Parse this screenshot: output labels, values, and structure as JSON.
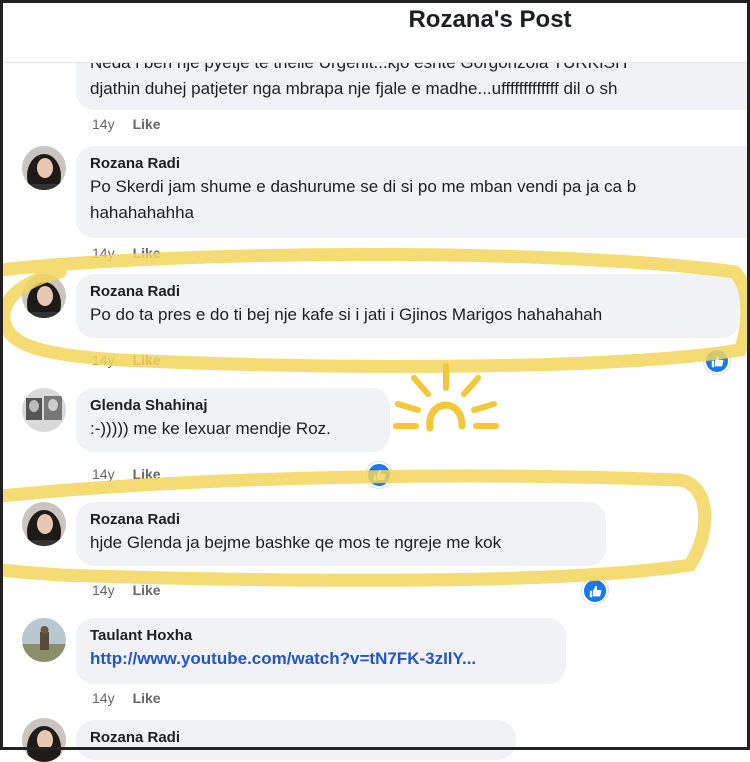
{
  "header": {
    "title": "Rozana's Post"
  },
  "comments": [
    {
      "author": "",
      "lines": [
        "Neda i beri nje pyetje te thelle Urgenit...kjo eshte Gorgonzola TURKISH",
        "djathin duhej patjeter nga mbrapa nje fjale e madhe...ufffffffffffff dil o sh"
      ],
      "time": "14y",
      "like": "Like"
    },
    {
      "author": "Rozana Radi",
      "lines": [
        "Po Skerdi jam shume e dashurume se di si po me mban vendi pa ja ca b",
        "hahahahahha"
      ],
      "time": "14y",
      "like": "Like"
    },
    {
      "author": "Rozana Radi",
      "lines": [
        "Po do ta pres e do ti bej nje kafe si i jati i Gjinos Marigos hahahahah"
      ],
      "time": "14y",
      "like": "Like"
    },
    {
      "author": "Glenda Shahinaj",
      "lines": [
        ":-))))) me ke lexuar mendje Roz."
      ],
      "time": "14y",
      "like": "Like"
    },
    {
      "author": "Rozana Radi",
      "lines": [
        "hjde Glenda ja bejme bashke qe mos te ngreje me kok"
      ],
      "time": "14y",
      "like": "Like"
    },
    {
      "author": "Taulant Hoxha",
      "lines": [
        "http://www.youtube.com/watch?v=tN7FK-3zIlY..."
      ],
      "time": "14y",
      "like": "Like"
    },
    {
      "author": "Rozana Radi",
      "lines": [],
      "time": "",
      "like": ""
    }
  ],
  "colors": {
    "highlighter": "#f2d55a",
    "like_blue": "#1877f2",
    "link": "#2355c8"
  },
  "icons": {
    "like": "thumbs-up-icon",
    "sun": "sun-doodle-icon"
  }
}
